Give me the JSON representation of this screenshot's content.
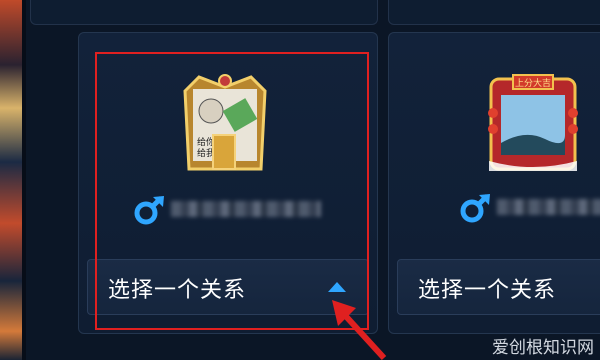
{
  "cards": [
    {
      "avatar_text": "给你250\n给我1个",
      "select_label": "选择一个关系",
      "username_hidden": true
    },
    {
      "avatar_banner": "上分大吉",
      "select_label": "选择一个关系",
      "username_hidden": true
    }
  ],
  "icons": {
    "gender": "male-icon",
    "dropdown": "chevron-up-icon"
  },
  "colors": {
    "accent_blue": "#2fa6ff",
    "highlight_red": "#e02020",
    "background": "#0b1626"
  },
  "watermark": "爱创根知识网"
}
